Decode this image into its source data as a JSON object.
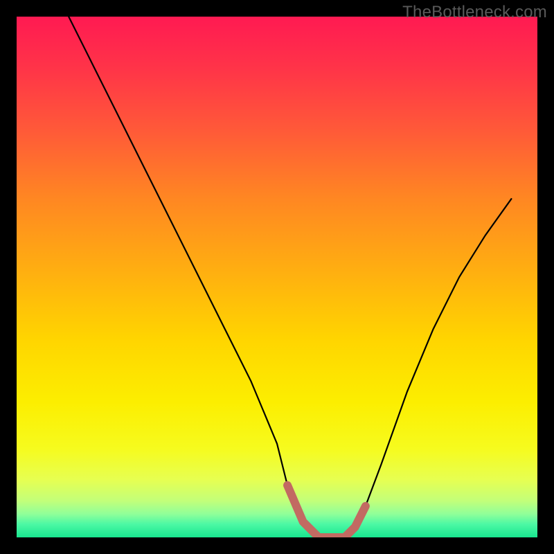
{
  "watermark": "TheBottleneck.com",
  "chart_data": {
    "type": "line",
    "title": "",
    "xlabel": "",
    "ylabel": "",
    "xlim": [
      0,
      100
    ],
    "ylim": [
      0,
      100
    ],
    "grid": false,
    "series": [
      {
        "name": "bottleneck-curve",
        "x": [
          10,
          15,
          20,
          25,
          30,
          35,
          40,
          45,
          50,
          52,
          55,
          58,
          60,
          63,
          65,
          67,
          70,
          75,
          80,
          85,
          90,
          95
        ],
        "values": [
          100,
          90,
          80,
          70,
          60,
          50,
          40,
          30,
          18,
          10,
          3,
          0,
          0,
          0,
          2,
          6,
          14,
          28,
          40,
          50,
          58,
          65
        ]
      }
    ],
    "overlay_segment": {
      "name": "recommended-range",
      "color": "#c26a62",
      "x": [
        52,
        55,
        58,
        60,
        63,
        65,
        67
      ],
      "values": [
        10,
        3,
        0,
        0,
        0,
        2,
        6
      ]
    },
    "background_gradient": {
      "stops": [
        {
          "offset": 0.0,
          "color": "#ff1a52"
        },
        {
          "offset": 0.1,
          "color": "#ff3448"
        },
        {
          "offset": 0.22,
          "color": "#ff5a38"
        },
        {
          "offset": 0.35,
          "color": "#ff8722"
        },
        {
          "offset": 0.5,
          "color": "#ffb20f"
        },
        {
          "offset": 0.62,
          "color": "#ffd500"
        },
        {
          "offset": 0.74,
          "color": "#fcee00"
        },
        {
          "offset": 0.83,
          "color": "#f6fb1e"
        },
        {
          "offset": 0.89,
          "color": "#e6ff52"
        },
        {
          "offset": 0.93,
          "color": "#c2ff7a"
        },
        {
          "offset": 0.955,
          "color": "#90ff99"
        },
        {
          "offset": 0.975,
          "color": "#4bf8a4"
        },
        {
          "offset": 1.0,
          "color": "#18e68f"
        }
      ]
    }
  }
}
